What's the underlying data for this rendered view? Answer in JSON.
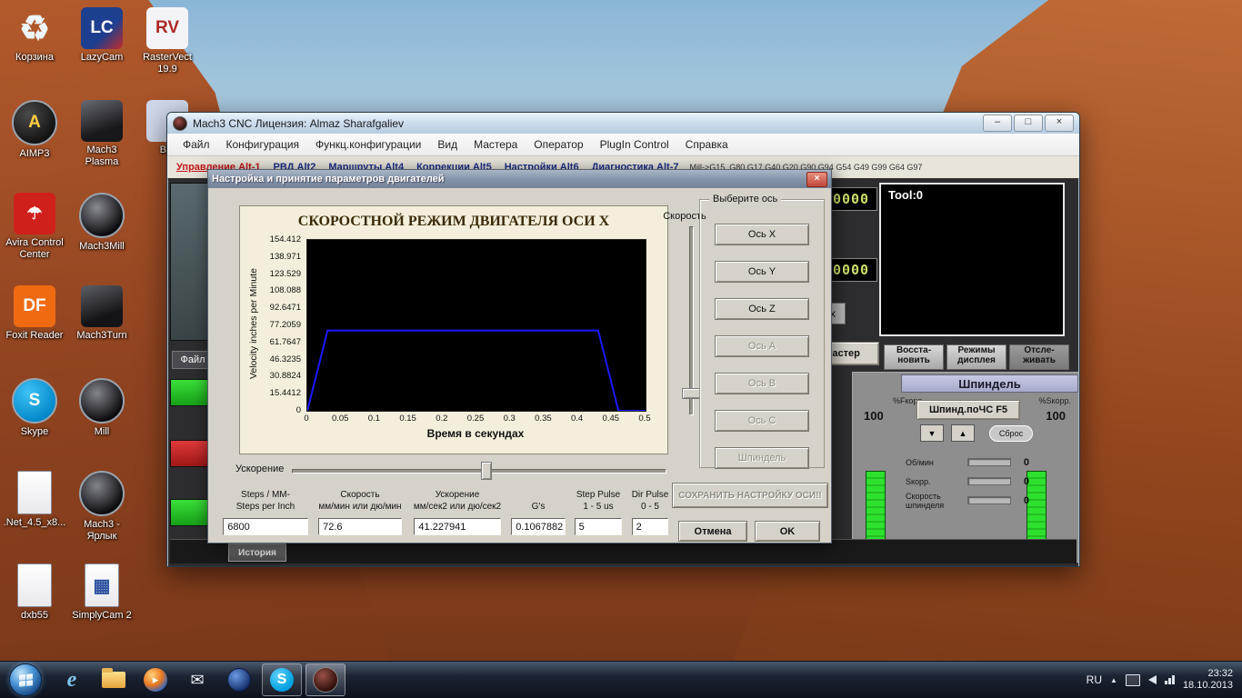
{
  "desktop": {
    "icon_columns": [
      [
        {
          "name": "recycle-bin",
          "label": "Корзина",
          "glyph": "♻",
          "shape": "plain",
          "fg": "#eef4f8"
        },
        {
          "name": "aimp3",
          "label": "AIMP3",
          "glyph": "A",
          "shape": "circle",
          "bg": "radial-gradient(circle at 35% 30%, #4a4a4a, #111 75%)",
          "fg": "#ffcf3f"
        },
        {
          "name": "avira-control-center",
          "label": "Avira Control\nCenter",
          "glyph": "☂",
          "shape": "sq",
          "bg": "#d0201c",
          "fg": "#ffffff"
        },
        {
          "name": "foxit-reader",
          "label": "Foxit Reader",
          "glyph": "DF",
          "shape": "sq",
          "bg": "#f06a12",
          "fg": "#ffffff"
        },
        {
          "name": "skype",
          "label": "Skype",
          "glyph": "S",
          "shape": "circle",
          "bg": "radial-gradient(circle at 35% 30%, #3fc2f5, #0087c9 75%)",
          "fg": "#ffffff"
        },
        {
          "name": "dotnet-installer",
          "label": ".Net_4.5_x8...",
          "glyph": "",
          "shape": "page"
        },
        {
          "name": "dxb55",
          "label": "dxb55",
          "glyph": "",
          "shape": "page"
        }
      ],
      [
        {
          "name": "lazycam",
          "label": "LazyCam",
          "glyph": "LC",
          "shape": "sq",
          "bg": "linear-gradient(135deg,#1d3f8f 60%, #c42a2a)",
          "fg": "#ffffff"
        },
        {
          "name": "mach3-plasma",
          "label": "Mach3\nPlasma",
          "glyph": "",
          "shape": "sq",
          "bg": "linear-gradient(160deg,#6a6a72,#17171c 70%)"
        },
        {
          "name": "mach3mill",
          "label": "Mach3Mill",
          "glyph": "",
          "shape": "circle",
          "bg": "radial-gradient(circle at 38% 32%, #8a8a92, #0c0c10 72%)"
        },
        {
          "name": "mach3turn",
          "label": "Mach3Turn",
          "glyph": "",
          "shape": "sq",
          "bg": "linear-gradient(160deg,#5e5e66,#141418 70%)"
        },
        {
          "name": "mill",
          "label": "Mill",
          "glyph": "",
          "shape": "circle",
          "bg": "radial-gradient(circle at 38% 32%, #84848c, #0c0c10 72%)"
        },
        {
          "name": "mach3-shortcut",
          "label": "Mach3 -\nЯрлык",
          "glyph": "",
          "shape": "circle",
          "bg": "radial-gradient(circle at 38% 32%, #84848c, #0c0c10 72%)"
        },
        {
          "name": "simplycam-2",
          "label": "SimplyCam 2",
          "glyph": "▦",
          "shape": "page",
          "fg": "#2b4fa0"
        }
      ],
      [
        {
          "name": "rastervect",
          "label": "RasterVect\n19.9",
          "glyph": "RV",
          "shape": "sq",
          "bg": "#f4f4f8",
          "fg": "#b02828"
        },
        {
          "name": "bm",
          "label": "Bm",
          "glyph": "",
          "shape": "sq",
          "bg": "#cfd8ea"
        }
      ]
    ]
  },
  "window": {
    "title": "Mach3 CNC  Лицензия: Almaz Sharafgaliev",
    "window_controls": [
      {
        "name": "minimize-button",
        "glyph": "–"
      },
      {
        "name": "maximize-button",
        "glyph": "□"
      },
      {
        "name": "close-button",
        "glyph": "×"
      }
    ],
    "menu_items": [
      {
        "name": "file",
        "label": "Файл"
      },
      {
        "name": "configuration",
        "label": "Конфигурация"
      },
      {
        "name": "function-configs",
        "label": "Функц.конфигурации"
      },
      {
        "name": "view",
        "label": "Вид"
      },
      {
        "name": "wizards",
        "label": "Мастера"
      },
      {
        "name": "operator",
        "label": "Оператор"
      },
      {
        "name": "plugin-control",
        "label": "PlugIn Control"
      },
      {
        "name": "help",
        "label": "Справка"
      }
    ],
    "tabs": [
      {
        "name": "program-run",
        "label": "Управление Alt-1",
        "active": true
      },
      {
        "name": "mdi",
        "label": "РВД Alt2",
        "active": false
      },
      {
        "name": "toolpath",
        "label": "Маршруты Alt4",
        "active": false
      },
      {
        "name": "offsets",
        "label": "Коррекции Alt5",
        "active": false
      },
      {
        "name": "settings",
        "label": "Настройки Alt6",
        "active": false
      },
      {
        "name": "diagnostics",
        "label": "Диагностика Alt-7",
        "active": false
      }
    ],
    "gcode_line": "Mill->G15, G80 G17 G40 G20 G90 G94 G54 G49 G99 G64 G97",
    "tool_display": "Tool:0",
    "dro_values": [
      "0000",
      "0000"
    ],
    "dro_x_label": "x",
    "wizard_button": "Мастер",
    "view_buttons": [
      "Восста-\nновить",
      "Режимы\nдисплея",
      "Отсле-\nживать"
    ],
    "file_label": "Файл",
    "history_button": "История",
    "spindle": {
      "title": "Шпиндель",
      "cw_button": "Шпинд.поЧС F5",
      "feed_override_label": "%Fкорр.",
      "spindle_override_label": "%Sкорр.",
      "feed_override_value": "100",
      "spindle_override_value": "100",
      "arrow_buttons": [
        "▼",
        "▲"
      ],
      "reset_button": "Сброс",
      "rows": [
        {
          "label": "Об/мин",
          "value": "0"
        },
        {
          "label": "Sкорр.",
          "value": "0"
        },
        {
          "label": "Скорость шпинделя",
          "value": "0"
        }
      ]
    }
  },
  "dialog": {
    "title": "Настройка и принятие параметров двигателей",
    "close_glyph": "×",
    "velocity_slider_label": "Скорость",
    "axis_group_label": "Выберите ось",
    "axis_buttons": [
      {
        "name": "axis-x",
        "label": "Ось X",
        "enabled": true
      },
      {
        "name": "axis-y",
        "label": "Ось Y",
        "enabled": true
      },
      {
        "name": "axis-z",
        "label": "Ось Z",
        "enabled": true
      },
      {
        "name": "axis-a",
        "label": "Ось A",
        "enabled": false
      },
      {
        "name": "axis-b",
        "label": "Ось B",
        "enabled": false
      },
      {
        "name": "axis-c",
        "label": "Ось C",
        "enabled": false
      },
      {
        "name": "spindle",
        "label": "Шпиндель",
        "enabled": false
      }
    ],
    "save_button": "СОХРАНИТЬ НАСТРОЙКУ ОСИ!!",
    "accel_slider_label": "Ускорение",
    "fields": [
      {
        "name": "steps-per-unit",
        "label1": "Steps / MM-",
        "label2": "Steps per Inch",
        "value": "6800"
      },
      {
        "name": "velocity",
        "label1": "Скорость",
        "label2": "мм/мин или дю/мин",
        "value": "72.6"
      },
      {
        "name": "acceleration",
        "label1": "Ускорение",
        "label2": "мм/сек2 или дю/сек2",
        "value": "41.227941"
      },
      {
        "name": "g-force",
        "label1": "",
        "label2": "G's",
        "value": "0.1067882"
      },
      {
        "name": "step-pulse",
        "label1": "Step Pulse",
        "label2": "1 - 5 us",
        "value": "5"
      },
      {
        "name": "dir-pulse",
        "label1": "Dir Pulse",
        "label2": "0 - 5",
        "value": "2"
      }
    ],
    "cancel_button": "Отмена",
    "ok_button": "OK"
  },
  "chart_data": {
    "type": "line",
    "title": "СКОРОСТНОЙ РЕЖИМ ДВИГАТЕЛЯ ОСИ X",
    "xlabel": "Время в секундах",
    "ylabel": "Velocity inches per Minute",
    "xlim": [
      0,
      0.5
    ],
    "ylim": [
      0,
      154.412
    ],
    "x_ticks": [
      "0",
      "0.05",
      "0.1",
      "0.15",
      "0.2",
      "0.25",
      "0.3",
      "0.35",
      "0.4",
      "0.45",
      "0.5"
    ],
    "y_ticks": [
      "154.412",
      "138.971",
      "123.529",
      "108.088",
      "92.6471",
      "77.2059",
      "61.7647",
      "46.3235",
      "30.8824",
      "15.4412",
      "0"
    ],
    "grid": false,
    "plot_bg": "#000000",
    "series": [
      {
        "name": "velocity-profile",
        "color": "#1a1aff",
        "points": [
          [
            0,
            0
          ],
          [
            0.03,
            72.6
          ],
          [
            0.43,
            72.6
          ],
          [
            0.46,
            0
          ],
          [
            0.5,
            0
          ]
        ]
      }
    ]
  },
  "taskbar": {
    "items": [
      {
        "name": "internet-explorer",
        "glyph": "e",
        "style": "ie",
        "open": false,
        "active": false
      },
      {
        "name": "windows-explorer",
        "glyph": "",
        "style": "folder",
        "open": false,
        "active": false
      },
      {
        "name": "media-player",
        "glyph": "▸",
        "style": "wmp",
        "open": false,
        "active": false
      },
      {
        "name": "messenger",
        "glyph": "✉",
        "style": "msg",
        "open": false,
        "active": false
      },
      {
        "name": "app-globe",
        "glyph": "",
        "style": "globe",
        "open": false,
        "active": false
      },
      {
        "name": "skype",
        "glyph": "S",
        "style": "skype",
        "open": true,
        "active": false
      },
      {
        "name": "mach3",
        "glyph": "",
        "style": "mach3",
        "open": true,
        "active": true
      }
    ],
    "tray": {
      "language": "RU",
      "hidden_icons_glyph": "▲",
      "time": "23:32",
      "date": "18.10.2013"
    }
  }
}
